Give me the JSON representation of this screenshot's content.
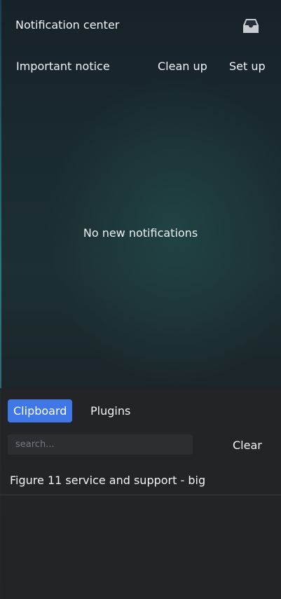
{
  "notification_center": {
    "title": "Notification center",
    "actions": {
      "important": "Important notice",
      "clean_up": "Clean up",
      "set_up": "Set up"
    },
    "empty_message": "No new notifications",
    "inbox_icon": "inbox-icon"
  },
  "clipboard_panel": {
    "tabs": [
      {
        "label": "Clipboard",
        "active": true
      },
      {
        "label": "Plugins",
        "active": false
      }
    ],
    "search": {
      "placeholder": "search...",
      "value": ""
    },
    "clear_label": "Clear",
    "items": [
      {
        "text": "Figure 11 service and support - big"
      }
    ]
  },
  "colors": {
    "accent": "#3f78e6",
    "text": "#f2f4f5",
    "panel_bg": "#242528"
  }
}
